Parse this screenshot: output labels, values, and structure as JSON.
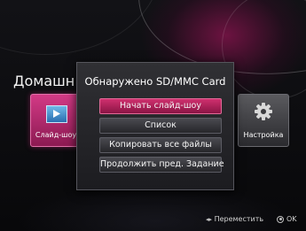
{
  "home": {
    "title": "Домашн",
    "tiles": [
      {
        "label": "Слайд-шоу",
        "icon": "slideshow-icon"
      },
      {
        "label": "Настройка",
        "icon": "gear-icon"
      }
    ]
  },
  "dialog": {
    "title": "Обнаружено SD/MMC Card",
    "options": [
      {
        "label": "Начать слайд-шоу",
        "selected": true
      },
      {
        "label": "Список",
        "selected": false
      },
      {
        "label": "Копировать все файлы",
        "selected": false
      },
      {
        "label": "Продолжить пред. Задание",
        "selected": false
      }
    ]
  },
  "footer": {
    "move_label": "Переместить",
    "move_icon": "left-right-arrows-icon",
    "ok_label": "OK",
    "ok_icon": "ok-button-icon"
  },
  "colors": {
    "accent": "#c2285f",
    "background": "#0a0a0c",
    "dialog": "#2a2a2e"
  }
}
